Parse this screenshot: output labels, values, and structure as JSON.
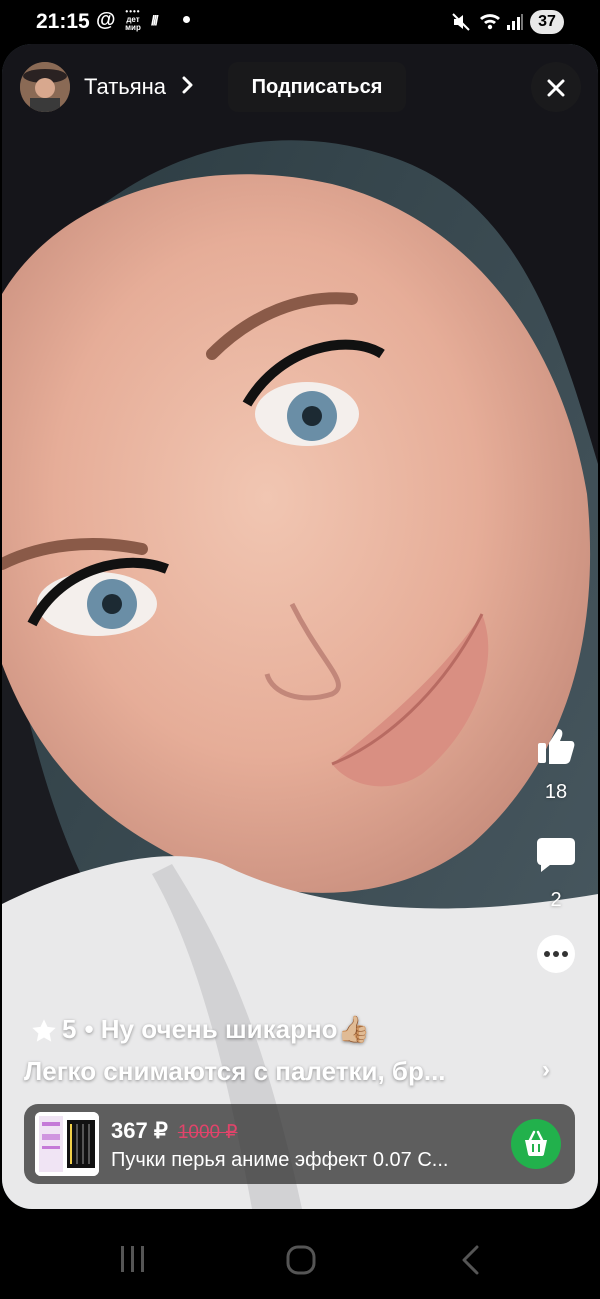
{
  "status_bar": {
    "time": "21:15",
    "at_symbol": "@",
    "notif_app_line1": "дет",
    "notif_app_line2": "мир",
    "slashes": "///",
    "battery": "37"
  },
  "post": {
    "author_name": "Татьяна",
    "subscribe_label": "Подписаться",
    "likes_count": "18",
    "comments_count": "2",
    "rating": "5",
    "review_title": "• Ну очень шикарно👍🏼",
    "review_text": "Легко снимаются с палетки, бр...",
    "more_chevron": "›"
  },
  "product": {
    "price": "367 ₽",
    "old_price": "1000 ₽",
    "name": "Пучки перья аниме эффект 0.07 С..."
  },
  "colors": {
    "cart_green": "#22b14c",
    "old_price_pink": "#e0446a"
  },
  "icons": [
    "mute-icon",
    "wifi-icon",
    "signal-icon",
    "chevron-right-icon",
    "close-icon",
    "like-icon",
    "comment-icon",
    "more-icon",
    "star-icon",
    "cart-icon",
    "nav-recents-icon",
    "nav-home-icon",
    "nav-back-icon"
  ]
}
